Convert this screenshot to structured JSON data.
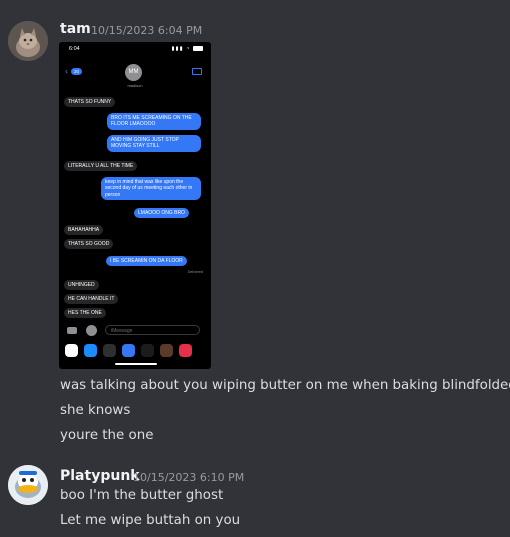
{
  "messages": [
    {
      "username": "tam",
      "timestamp": "10/15/2023 6:04 PM",
      "attachment": {
        "status_time": "6:04",
        "back_count": "20",
        "contact_initials": "MM",
        "contact_name": "madison",
        "bubbles": [
          {
            "text": "THATS SO FUNNY",
            "side": "in"
          },
          {
            "text": "BRO ITS ME SCREAMING ON THE FLOOR LMAOOOO",
            "side": "out"
          },
          {
            "text": "AND HIM GOING JUST STOP MOVING STAY STILL",
            "side": "out"
          },
          {
            "text": "LITERALLY U ALL THE TIME",
            "side": "in"
          },
          {
            "text": "keep in mind that was like upon the second day of us meeting each other in person",
            "side": "out"
          },
          {
            "text": "LMAOOO ONG BRO",
            "side": "out"
          },
          {
            "text": "BAHAHAHHA",
            "side": "in"
          },
          {
            "text": "THATS SO GOOD",
            "side": "in"
          },
          {
            "text": "I BE SCREAMIN ON DA FLOOR",
            "side": "out"
          },
          {
            "text": "UNHINGED",
            "side": "in"
          },
          {
            "text": "HE CAN HANDLE IT",
            "side": "in"
          },
          {
            "text": "HES THE ONE",
            "side": "in"
          }
        ],
        "delivered": "Delivered",
        "input_placeholder": "iMessage"
      },
      "lines": [
        "was talking about you wiping butter on me when baking blindfolded",
        "she knows",
        "youre the one"
      ]
    },
    {
      "username": "Platypunk",
      "timestamp": "10/15/2023 6:10 PM",
      "lines": [
        "boo I'm the butter ghost",
        "Let me wipe buttah on you"
      ]
    }
  ],
  "colors": {
    "background": "#313338",
    "imessage_blue": "#3478f6",
    "received_gray": "#262628"
  }
}
